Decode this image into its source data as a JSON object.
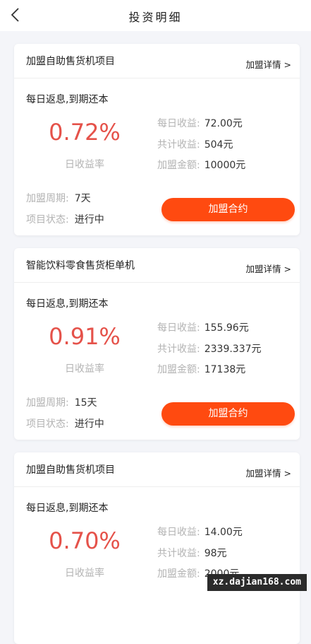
{
  "header": {
    "title": "投资明细",
    "back_icon": "chevron-left-icon"
  },
  "colors": {
    "rate": "#e5524a",
    "button": "#ff4a10",
    "muted": "#b3b3b3",
    "page_bg": "#f4f5f9"
  },
  "labels": {
    "detail": "加盟详情 >",
    "repay": "每日返息,到期还本",
    "rate_label": "日收益率",
    "daily_income": "每日收益:",
    "total_income": "共计收益:",
    "amount": "加盟金额:",
    "period": "加盟周期:",
    "status": "项目状态:",
    "join_button": "加盟合约"
  },
  "cards": [
    {
      "name": "加盟自助售货机项目",
      "rate": "0.72%",
      "daily_income": "72.00元",
      "total_income": "504元",
      "amount": "10000元",
      "period": "7天",
      "status": "进行中"
    },
    {
      "name": "智能饮料零食售货柜单机",
      "rate": "0.91%",
      "daily_income": "155.96元",
      "total_income": "2339.337元",
      "amount": "17138元",
      "period": "15天",
      "status": "进行中"
    },
    {
      "name": "加盟自助售货机项目",
      "rate": "0.70%",
      "daily_income": "14.00元",
      "total_income": "98元",
      "amount": "2000元"
    }
  ],
  "watermark": "xz.dajian168.com"
}
